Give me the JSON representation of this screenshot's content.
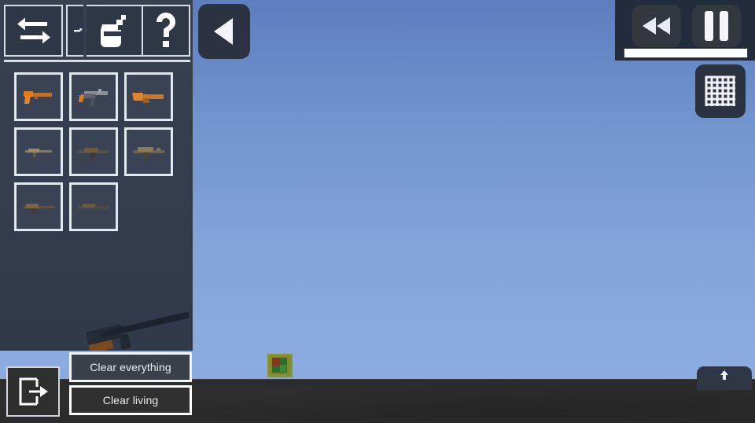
{
  "app": {
    "title": "Sandbox Shooter",
    "theme": {
      "sidebar_bg": "#333d4d",
      "sky_top": "#5d7dbe",
      "sky_bottom": "#8cabdf",
      "ground": "#2b2b2c",
      "panel_border": "#ffffff",
      "button_dark": "#303030",
      "accent_white": "#f2f4f7"
    }
  },
  "toolbar": {
    "buttons": [
      {
        "name": "swap-icon",
        "label": "Swap",
        "title": "Swap weapons"
      },
      {
        "name": "next-arrow-icon",
        "label": "Next",
        "title": "Next"
      },
      {
        "name": "spray-can-icon",
        "label": "Spray",
        "title": "Spray / paint"
      },
      {
        "name": "help-icon",
        "label": "?",
        "title": "Help"
      }
    ]
  },
  "weapon_grid": {
    "label": "Weapons",
    "rows": [
      [
        {
          "name": "weapon-pistol",
          "label": "Pistol",
          "selected": false
        },
        {
          "name": "weapon-smg",
          "label": "SMG",
          "selected": false
        },
        {
          "name": "weapon-sawnoff",
          "label": "Sawn-off",
          "selected": false
        }
      ],
      [
        {
          "name": "weapon-rifle",
          "label": "Rifle",
          "selected": false
        },
        {
          "name": "weapon-carbine",
          "label": "Carbine",
          "selected": false
        },
        {
          "name": "weapon-assault",
          "label": "Assault Rifle",
          "selected": false
        }
      ],
      [
        {
          "name": "weapon-sniper",
          "label": "Sniper",
          "selected": false
        },
        {
          "name": "weapon-shotgun",
          "label": "Shotgun",
          "selected": false
        }
      ]
    ]
  },
  "bottom_panel": {
    "exit_button": {
      "name": "exit-icon",
      "label": "Exit"
    },
    "clear_everything": "Clear everything",
    "clear_living": "Clear living"
  },
  "world": {
    "back_button": {
      "name": "back-arrow-icon",
      "label": "Back"
    },
    "grid_button": {
      "name": "grid-icon",
      "label": "Grid"
    },
    "block_entity": {
      "name": "block-entity",
      "label": "Block"
    },
    "bottom_right_button": {
      "name": "upload-icon",
      "label": "Upload"
    }
  },
  "playback": {
    "rewind": {
      "name": "rewind-icon",
      "label": "Rewind"
    },
    "pause": {
      "name": "pause-icon",
      "label": "Pause"
    },
    "progress_percent": 100
  }
}
